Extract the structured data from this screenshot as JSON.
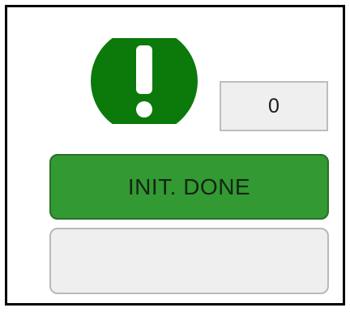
{
  "status": {
    "icon": "exclamation-circle-icon",
    "color": "#0b7a0b"
  },
  "counter": {
    "value": "0"
  },
  "buttons": {
    "init_label": "INIT. DONE",
    "init_color": "#339933",
    "blank_label": ""
  }
}
